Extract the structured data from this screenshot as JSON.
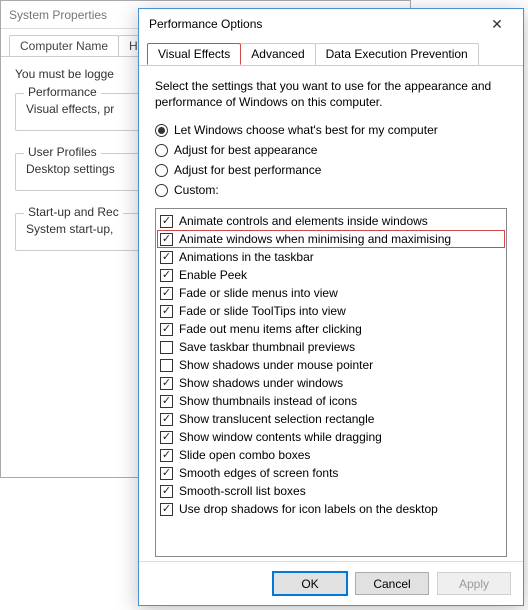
{
  "sysprops": {
    "title": "System Properties",
    "tabs": [
      "Computer Name",
      "H"
    ],
    "login_notice": "You must be logge",
    "groups": {
      "performance": {
        "legend": "Performance",
        "desc": "Visual effects, pr"
      },
      "user_profiles": {
        "legend": "User Profiles",
        "desc": "Desktop settings"
      },
      "startup": {
        "legend": "Start-up and Rec",
        "desc": "System start-up,"
      }
    }
  },
  "perf": {
    "title": "Performance Options",
    "close_glyph": "✕",
    "tabs": {
      "visual": "Visual Effects",
      "advanced": "Advanced",
      "dep": "Data Execution Prevention",
      "active": "visual"
    },
    "intro": "Select the settings that you want to use for the appearance and performance of Windows on this computer.",
    "radios": [
      {
        "label": "Let Windows choose what's best for my computer",
        "checked": true
      },
      {
        "label": "Adjust for best appearance",
        "checked": false
      },
      {
        "label": "Adjust for best performance",
        "checked": false
      },
      {
        "label": "Custom:",
        "checked": false
      }
    ],
    "options": [
      {
        "label": "Animate controls and elements inside windows",
        "checked": true,
        "highlight": false
      },
      {
        "label": "Animate windows when minimising and maximising",
        "checked": true,
        "highlight": true
      },
      {
        "label": "Animations in the taskbar",
        "checked": true,
        "highlight": false
      },
      {
        "label": "Enable Peek",
        "checked": true,
        "highlight": false
      },
      {
        "label": "Fade or slide menus into view",
        "checked": true,
        "highlight": false
      },
      {
        "label": "Fade or slide ToolTips into view",
        "checked": true,
        "highlight": false
      },
      {
        "label": "Fade out menu items after clicking",
        "checked": true,
        "highlight": false
      },
      {
        "label": "Save taskbar thumbnail previews",
        "checked": false,
        "highlight": false
      },
      {
        "label": "Show shadows under mouse pointer",
        "checked": false,
        "highlight": false
      },
      {
        "label": "Show shadows under windows",
        "checked": true,
        "highlight": false
      },
      {
        "label": "Show thumbnails instead of icons",
        "checked": true,
        "highlight": false
      },
      {
        "label": "Show translucent selection rectangle",
        "checked": true,
        "highlight": false
      },
      {
        "label": "Show window contents while dragging",
        "checked": true,
        "highlight": false
      },
      {
        "label": "Slide open combo boxes",
        "checked": true,
        "highlight": false
      },
      {
        "label": "Smooth edges of screen fonts",
        "checked": true,
        "highlight": false
      },
      {
        "label": "Smooth-scroll list boxes",
        "checked": true,
        "highlight": false
      },
      {
        "label": "Use drop shadows for icon labels on the desktop",
        "checked": true,
        "highlight": false
      }
    ],
    "buttons": {
      "ok": "OK",
      "cancel": "Cancel",
      "apply": "Apply"
    }
  }
}
